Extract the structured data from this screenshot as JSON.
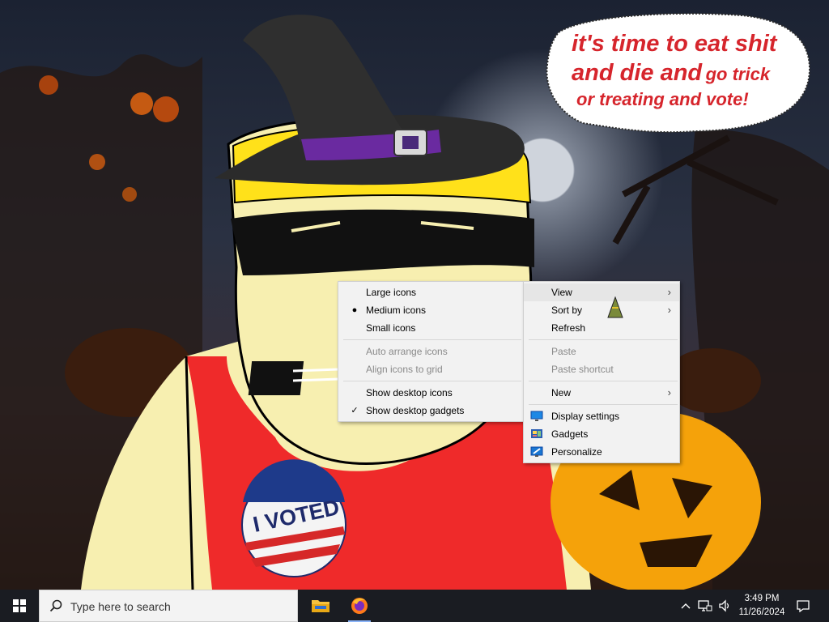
{
  "wallpaper": {
    "speech_bubble": {
      "line1": "it's time to eat shit",
      "line2a": "and die and",
      "line2b": "go trick",
      "line3": "or treating and vote!"
    },
    "sticker_text": "I VOTED"
  },
  "view_submenu": {
    "items": [
      {
        "label": "Large icons"
      },
      {
        "label": "Medium icons",
        "mark": "●"
      },
      {
        "label": "Small icons"
      },
      {
        "label": "Auto arrange icons",
        "disabled": true
      },
      {
        "label": "Align icons to grid",
        "disabled": true
      },
      {
        "label": "Show desktop icons"
      },
      {
        "label": "Show desktop gadgets",
        "mark": "✓"
      }
    ]
  },
  "context_menu": {
    "items": [
      {
        "label": "View",
        "arrow": "›"
      },
      {
        "label": "Sort by",
        "arrow": "›"
      },
      {
        "label": "Refresh"
      },
      {
        "label": "Paste",
        "disabled": true
      },
      {
        "label": "Paste shortcut",
        "disabled": true
      },
      {
        "label": "New",
        "arrow": "›"
      },
      {
        "label": "Display settings",
        "icon": "display-settings-icon"
      },
      {
        "label": "Gadgets",
        "icon": "gadgets-icon"
      },
      {
        "label": "Personalize",
        "icon": "personalize-icon"
      }
    ]
  },
  "taskbar": {
    "search_placeholder": "Type here to search",
    "apps": [
      {
        "name": "File Explorer",
        "icon": "folder-icon"
      },
      {
        "name": "Firefox",
        "icon": "firefox-icon"
      }
    ],
    "tray": {
      "chevron": "^",
      "time": "3:49 PM",
      "date": "11/26/2024"
    }
  },
  "colors": {
    "taskbar": "#1a1c22",
    "menu_bg": "#f2f2f2",
    "speech_text": "#d6252c"
  }
}
